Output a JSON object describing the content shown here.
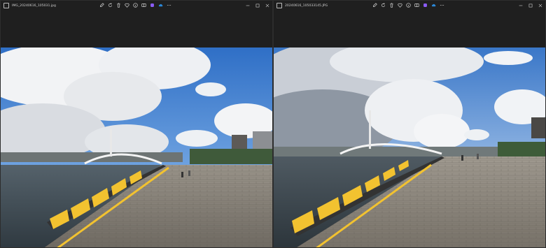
{
  "windows": [
    {
      "title": "IMG_20240616_105031.jpg",
      "toolbar_icons": [
        "edit-icon",
        "rotate-icon",
        "delete-icon",
        "favorite-icon",
        "info-icon",
        "compare-icon",
        "copilot-icon",
        "onedrive-icon",
        "more-icon"
      ],
      "caption_buttons": [
        "minimize-icon",
        "maximize-icon",
        "close-icon"
      ]
    },
    {
      "title": "20240616_105033145.JPG",
      "toolbar_icons": [
        "edit-icon",
        "rotate-icon",
        "delete-icon",
        "favorite-icon",
        "info-icon",
        "compare-icon",
        "copilot-icon",
        "onedrive-icon",
        "more-icon"
      ],
      "caption_buttons": [
        "minimize-icon",
        "maximize-icon",
        "close-icon"
      ]
    }
  ],
  "colors": {
    "window_bg": "#1f1f1f",
    "title_text": "#cfcfcf",
    "icon_stroke": "#d0d0d0",
    "copilot_accent": "#8b5cf6",
    "onedrive_accent": "#2b88d8",
    "sky_top": "#2f6fc6",
    "pavement": "#8a847b",
    "water": "#3a4750",
    "curb_yellow": "#f2c230"
  },
  "photos": [
    {
      "scene": "harbor-promenade-photo"
    },
    {
      "scene": "harbor-promenade-photo"
    }
  ]
}
